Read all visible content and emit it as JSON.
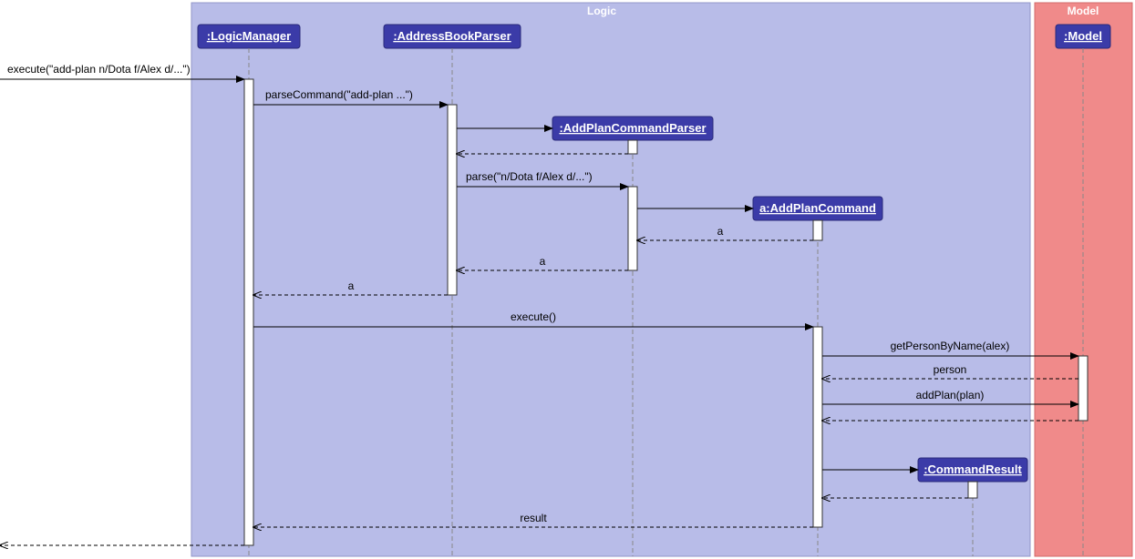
{
  "domain": "Diagram",
  "regions": {
    "logic": {
      "title": "Logic"
    },
    "model": {
      "title": "Model"
    }
  },
  "participants": {
    "logicManager": ":LogicManager",
    "addressBookParser": ":AddressBookParser",
    "addPlanCommandParser": ":AddPlanCommandParser",
    "addPlanCommand": "a:AddPlanCommand",
    "model": ":Model",
    "commandResult": ":CommandResult"
  },
  "messages": {
    "executeEntry": "execute(\"add-plan n/Dota f/Alex d/...\")",
    "parseCommand": "parseCommand(\"add-plan ...\")",
    "parse": "parse(\"n/Dota f/Alex d/...\")",
    "returnA1": "a",
    "returnA2": "a",
    "returnA3": "a",
    "execute": "execute()",
    "getPerson": "getPersonByName(alex)",
    "returnPerson": "person",
    "addPlan": "addPlan(plan)",
    "returnResult": "result"
  }
}
